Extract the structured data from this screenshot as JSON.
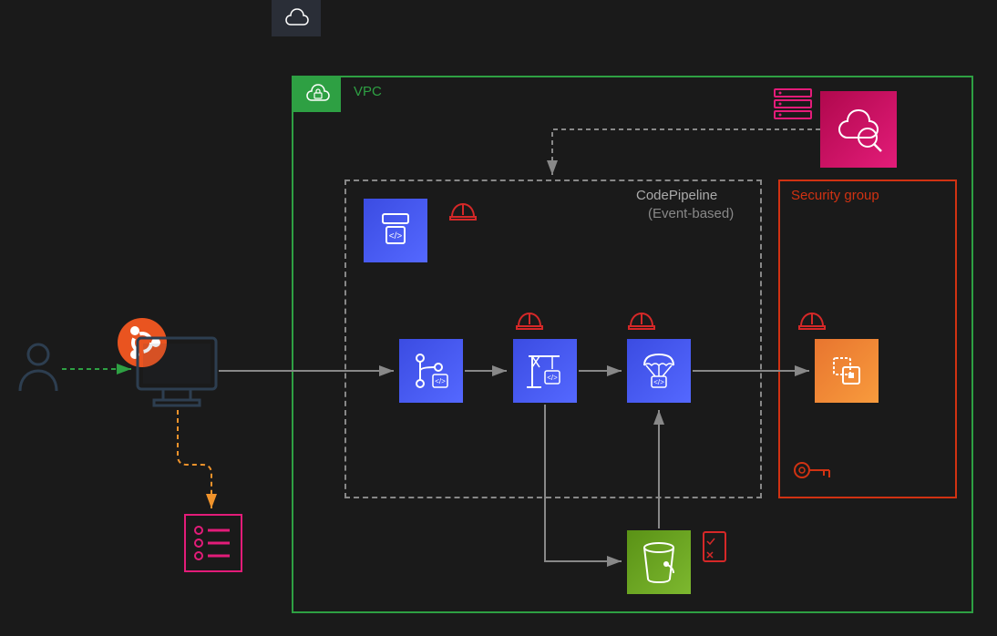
{
  "labels": {
    "vpc": "VPC",
    "codepipeline": "CodePipeline",
    "eventbased": "(Event-based)",
    "securitygroup": "Security group"
  },
  "colors": {
    "vpc_border": "#2ea043",
    "pipeline_border": "#888888",
    "security_border": "#d13212",
    "blue": "#4a5ff0",
    "orange": "#f0932b",
    "green": "#6ab04c",
    "pink": "#e31c79",
    "helmet": "#d62828",
    "orange_dash": "#f0932b",
    "green_dash": "#2ea043"
  },
  "icons": {
    "cloud": "cloud-icon",
    "vpc_lock": "vpc-lock-icon",
    "user": "user-icon",
    "ubuntu": "ubuntu-icon",
    "computer": "computer-icon",
    "checklist": "checklist-icon",
    "codecommit_main": "codecommit-icon",
    "codecommit_branch": "branch-icon",
    "codebuild": "codebuild-icon",
    "codedeploy": "codedeploy-icon",
    "compute": "compute-icon",
    "s3": "s3-bucket-icon",
    "cloudwatch": "cloudwatch-icon",
    "servers": "servers-icon",
    "key": "key-icon",
    "task": "task-icon",
    "helmet": "hardhat-icon"
  }
}
